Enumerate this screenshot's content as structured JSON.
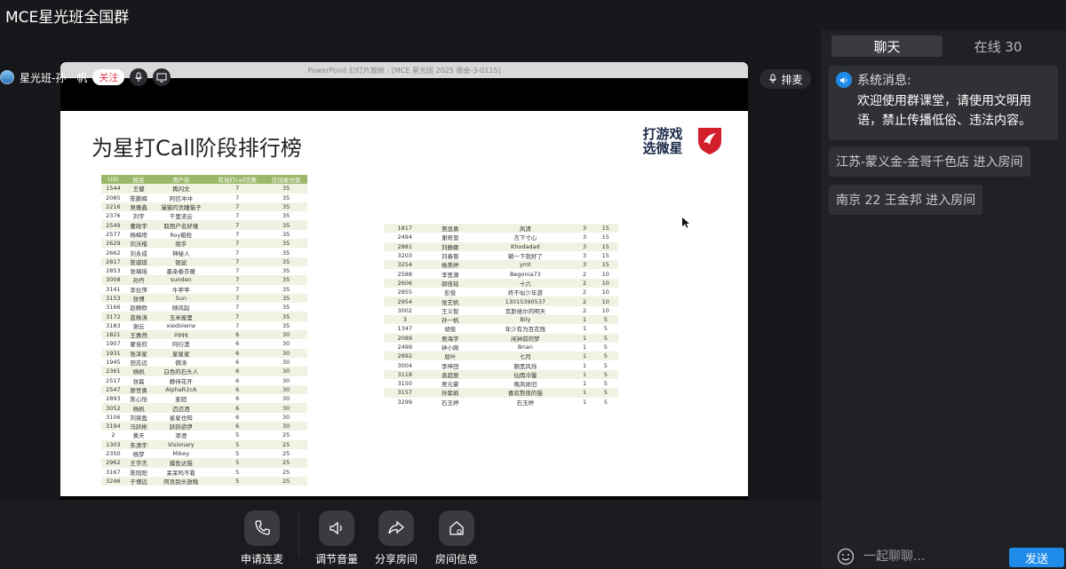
{
  "window": {
    "title": "MCE星光班全国群"
  },
  "presenter": {
    "name": "星光班-孙一帆",
    "follow_label": "关注",
    "queue_label": "排麦"
  },
  "ppt": {
    "window_title": "PowerPoint 幻灯片放映 - [MCE 星光班 2025 周会-3-0115]",
    "slide_title": "为星打Call阶段排行榜",
    "logo_line1": "打游戏",
    "logo_line2": "选微星",
    "left_headers": [
      "UID",
      "姓名",
      "用户名",
      "有效打call次数",
      "应加星光值"
    ],
    "left_rows": [
      [
        "1544",
        "王健",
        "再闪文",
        "7",
        "35"
      ],
      [
        "2085",
        "陈鹏辉",
        "阿信冲冲",
        "7",
        "35"
      ],
      [
        "2216",
        "吴雅鑫",
        "漫猫的贪睡猫子",
        "7",
        "35"
      ],
      [
        "2376",
        "刘宇",
        "千里流云",
        "7",
        "35"
      ],
      [
        "2549",
        "董政宇",
        "取用户名好难",
        "7",
        "35"
      ],
      [
        "2577",
        "杨梅塔",
        "Roy粗粒",
        "7",
        "35"
      ],
      [
        "2629",
        "刘沃楷",
        "炮手",
        "7",
        "35"
      ],
      [
        "2662",
        "刘永成",
        "神秘人",
        "7",
        "35"
      ],
      [
        "2817",
        "陈骐琪",
        "银鼠",
        "7",
        "35"
      ],
      [
        "2853",
        "张瑀瑶",
        "墨染春衣暖",
        "7",
        "35"
      ],
      [
        "3008",
        "孙丹",
        "sunden",
        "7",
        "35"
      ],
      [
        "3141",
        "李拉萍",
        "牛苹苹",
        "7",
        "35"
      ],
      [
        "3153",
        "张博",
        "Sun",
        "7",
        "35"
      ],
      [
        "3166",
        "赵静欧",
        "随风起",
        "7",
        "35"
      ],
      [
        "3172",
        "蓝杨涛",
        "玉米屋里",
        "7",
        "35"
      ],
      [
        "3183",
        "谢云",
        "xiedoiwrw",
        "7",
        "35"
      ],
      [
        "1821",
        "王惠然",
        "zqqq",
        "6",
        "30"
      ],
      [
        "1907",
        "翟佳欣",
        "阿衍澳",
        "6",
        "30"
      ],
      [
        "1931",
        "张泽星",
        "星星星",
        "6",
        "30"
      ],
      [
        "1945",
        "田志远",
        "佣涛",
        "6",
        "30"
      ],
      [
        "2361",
        "杨帆",
        "白色的石头人",
        "6",
        "30"
      ],
      [
        "2517",
        "张磊",
        "静待花开",
        "6",
        "30"
      ],
      [
        "2547",
        "廖世勇",
        "AlphaR2cA",
        "6",
        "30"
      ],
      [
        "2893",
        "陈心怡",
        "麦陌",
        "6",
        "30"
      ],
      [
        "3052",
        "杨帆",
        "迈迈洒",
        "6",
        "30"
      ],
      [
        "3106",
        "刘梁盈",
        "星星也知",
        "6",
        "30"
      ],
      [
        "3194",
        "马跃彬",
        "跃跃欲伊",
        "6",
        "30"
      ],
      [
        "2",
        "黄天",
        "添澄",
        "5",
        "25"
      ],
      [
        "1303",
        "朱清宇",
        "Visionary",
        "5",
        "25"
      ],
      [
        "2350",
        "杨梦",
        "Mikey",
        "5",
        "25"
      ],
      [
        "2962",
        "王宇杰",
        "摸鱼达猫",
        "5",
        "25"
      ],
      [
        "3167",
        "陈阳阳",
        "呆呆吗不看",
        "5",
        "25"
      ],
      [
        "3246",
        "于博远",
        "阿良别头放晚",
        "5",
        "25"
      ]
    ],
    "right_rows": [
      [
        "1817",
        "吴显勇",
        "风清",
        "3",
        "15"
      ],
      [
        "2494",
        "谢奇恩",
        "言下寸心",
        "3",
        "15"
      ],
      [
        "2881",
        "刘静娜",
        "Khodadad",
        "3",
        "15"
      ],
      [
        "3203",
        "刘春晋",
        "躺一下就好了",
        "3",
        "15"
      ],
      [
        "3254",
        "杨美婷",
        "ymt",
        "3",
        "15"
      ],
      [
        "2588",
        "李思源",
        "Begonia73",
        "2",
        "10"
      ],
      [
        "2606",
        "郭佳铭",
        "十六",
        "2",
        "10"
      ],
      [
        "2855",
        "彭俊",
        "终不似少年游",
        "2",
        "10"
      ],
      [
        "2954",
        "张艺帆",
        "13015390537",
        "2",
        "10"
      ],
      [
        "3002",
        "王义智",
        "克斯维尔的明天",
        "2",
        "10"
      ],
      [
        "3",
        "孙一帆",
        "Bily",
        "1",
        "5"
      ],
      [
        "1347",
        "胡俊",
        "年少有为百花残",
        "1",
        "5"
      ],
      [
        "2089",
        "吴海宇",
        "闲钟前的梦",
        "1",
        "5"
      ],
      [
        "2499",
        "钟小刚",
        "Brian",
        "1",
        "5"
      ],
      [
        "2892",
        "屈叶",
        "七月",
        "1",
        "5"
      ],
      [
        "3004",
        "李梓田",
        "颤黑风烁",
        "1",
        "5"
      ],
      [
        "3118",
        "袁超辰",
        "仙雨冷馨",
        "1",
        "5"
      ],
      [
        "3150",
        "吴元豪",
        "晚风依旧",
        "1",
        "5"
      ],
      [
        "3157",
        "孙紫鹃",
        "喜欢熬夜的猫",
        "1",
        "5"
      ],
      [
        "3299",
        "石玉婷",
        "石玉婷",
        "1",
        "5"
      ]
    ]
  },
  "controls": {
    "apply_mic": "申请连麦",
    "volume": "调节音量",
    "share": "分享房间",
    "info": "房间信息"
  },
  "sidebar": {
    "tab_chat": "聊天",
    "tab_online": "在线 30",
    "system_header": "系统消息:",
    "system_body": "欢迎使用群课堂，请使用文明用语，禁止传播低俗、违法内容。",
    "join1": "江苏-蒙义金-金哥千色店 进入房间",
    "join2": "南京 22 王金邦 进入房间",
    "input_placeholder": "一起聊聊...",
    "send_label": "发送"
  },
  "colors": {
    "accent": "#1e8be8",
    "table_header": "#9bb86a",
    "table_stripe": "#eef3e2",
    "msi_red": "#d21f2b"
  }
}
